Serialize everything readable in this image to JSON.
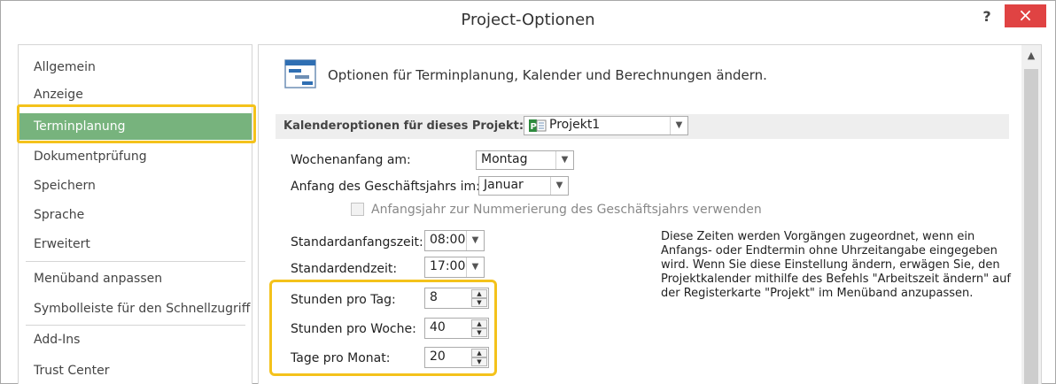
{
  "window": {
    "title": "Project-Optionen",
    "help_label": "?",
    "close_label": "×"
  },
  "nav": {
    "items": [
      {
        "label": "Allgemein"
      },
      {
        "label": "Anzeige"
      },
      {
        "label": "Terminplanung",
        "selected": true
      },
      {
        "label": "Dokumentprüfung"
      },
      {
        "label": "Speichern"
      },
      {
        "label": "Sprache"
      },
      {
        "label": "Erweitert"
      },
      {
        "label": "Menüband anpassen"
      },
      {
        "label": "Symbolleiste für den Schnellzugriff"
      },
      {
        "label": "Add-Ins"
      },
      {
        "label": "Trust Center"
      }
    ]
  },
  "content": {
    "header": "Optionen für Terminplanung, Kalender und Berechnungen ändern.",
    "section_label": "Kalenderoptionen für dieses Projekt:",
    "project_select": "Projekt1",
    "week_start": {
      "label": "Wochenanfang am:",
      "value": "Montag"
    },
    "fiscal_start": {
      "label": "Anfang des Geschäftsjahrs im:",
      "value": "Januar"
    },
    "fiscal_numbering": {
      "label": "Anfangsjahr zur Nummerierung des Geschäftsjahrs verwenden",
      "checked": false
    },
    "default_start": {
      "label": "Standardanfangszeit:",
      "value": "08:00"
    },
    "default_end": {
      "label": "Standardendzeit:",
      "value": "17:00"
    },
    "hours_per_day": {
      "label": "Stunden pro Tag:",
      "value": "8"
    },
    "hours_per_week": {
      "label": "Stunden pro Woche:",
      "value": "40"
    },
    "days_per_month": {
      "label": "Tage pro Monat:",
      "value": "20"
    },
    "info_text": "Diese Zeiten werden Vorgängen zugeordnet, wenn ein Anfangs- oder Endtermin ohne Uhrzeitangabe eingegeben wird. Wenn Sie diese Einstellung ändern, erwägen Sie, den Projektkalender mithilfe des Befehls \"Arbeitszeit ändern\" auf der Registerkarte \"Projekt\" im Menüband anzupassen."
  },
  "colors": {
    "selected_nav": "#77b37d",
    "highlight": "#f4c21b",
    "close_button": "#e04343"
  }
}
